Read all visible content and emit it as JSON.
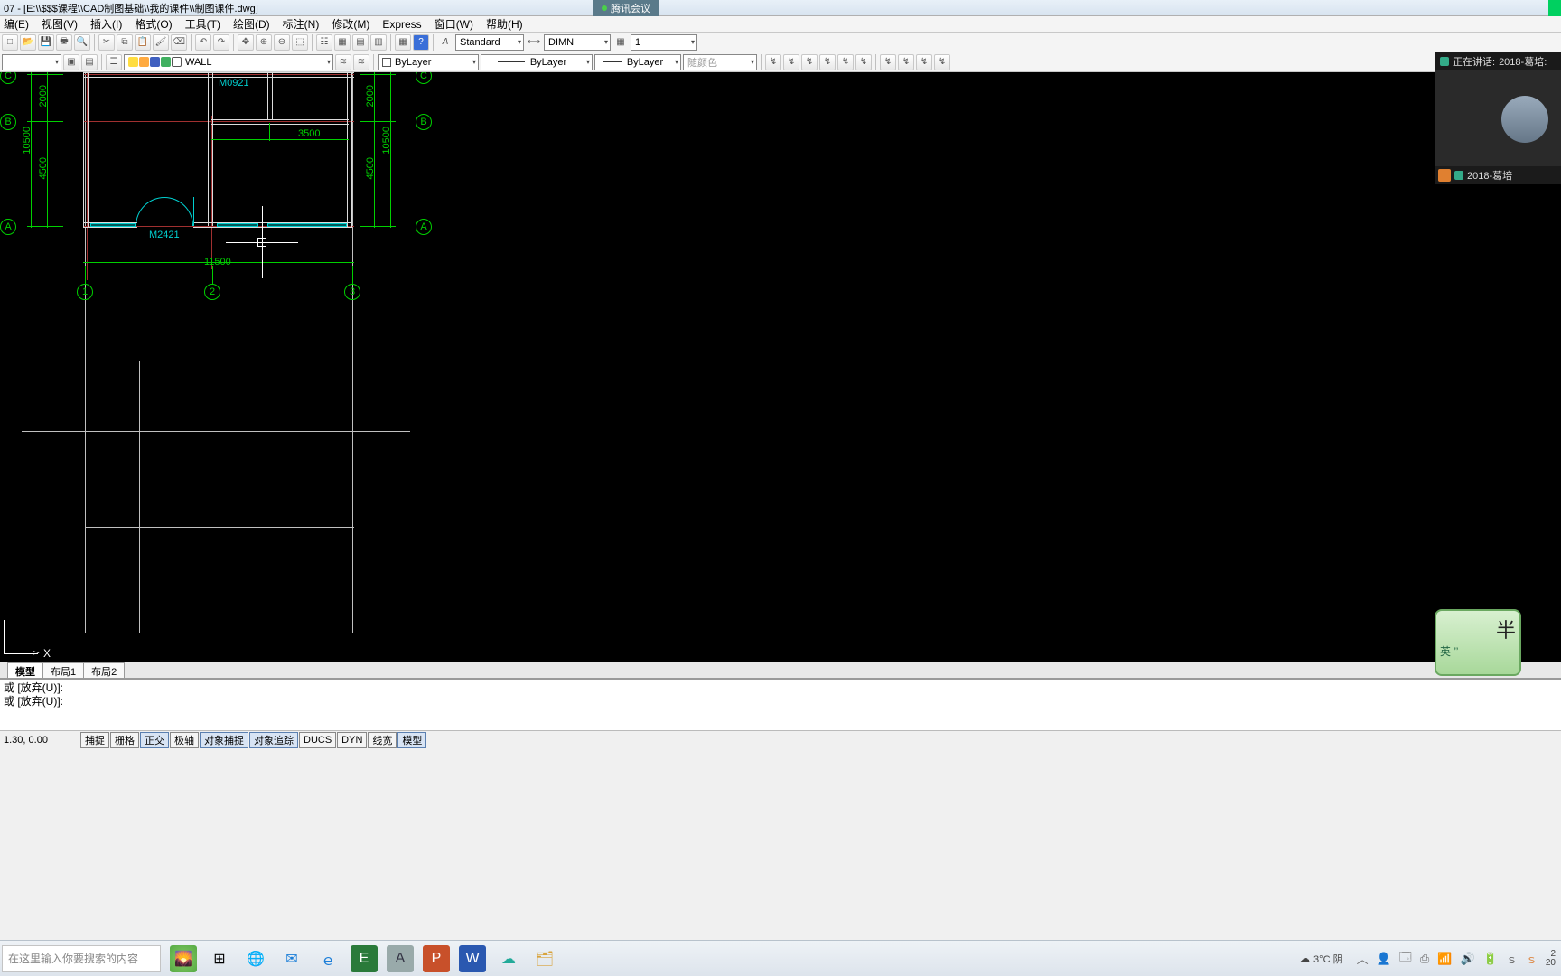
{
  "title": "07 - [E:\\\\$$$课程\\\\CAD制图基础\\\\我的课件\\\\制图课件.dwg]",
  "meeting_badge": "腾讯会议",
  "menu": [
    "编(E)",
    "视图(V)",
    "插入(I)",
    "格式(O)",
    "工具(T)",
    "绘图(D)",
    "标注(N)",
    "修改(M)",
    "Express",
    "窗口(W)",
    "帮助(H)"
  ],
  "toolbar2": {
    "style": "Standard",
    "dim": "DIMN",
    "lw": "1"
  },
  "toolbar3": {
    "layer": "WALL",
    "bylayer1": "ByLayer",
    "linetype": "ByLayer",
    "lineweight": "ByLayer",
    "color_placeholder": "随颜色"
  },
  "drawing": {
    "dims": {
      "d1": "10500",
      "d2": "2000",
      "d3": "4500",
      "d4": "3500",
      "d5": "11500",
      "d6": "2000",
      "d7": "10500",
      "d8": "4500"
    },
    "labels": {
      "m1": "M0921",
      "m2": "M2421"
    },
    "grid_top": [
      "C",
      "B",
      "A"
    ],
    "grid_right": [
      "C",
      "B",
      "A"
    ],
    "grid_bottom": [
      "1",
      "2",
      "3"
    ]
  },
  "meeting": {
    "speaking_prefix": "正在讲话:",
    "speaker": "2018-葛培:",
    "user": "2018-葛培"
  },
  "tabs": [
    "模型",
    "布局1",
    "布局2"
  ],
  "cmd": {
    "l1": "或  [放弃(U)]:",
    "l2": "或  [放弃(U)]:"
  },
  "status": {
    "coord": "1.30, 0.00",
    "toggles": [
      "捕捉",
      "栅格",
      "正交",
      "极轴",
      "对象捕捉",
      "对象追踪",
      "DUCS",
      "DYN",
      "线宽",
      "模型"
    ]
  },
  "ime": {
    "t1": "半",
    "t2": "英 ’’"
  },
  "taskbar": {
    "search_placeholder": "在这里输入你要搜索的内容",
    "weather": "3°C 阴",
    "time1": "2",
    "time2": "20"
  },
  "ucs": {
    "x": "X"
  }
}
